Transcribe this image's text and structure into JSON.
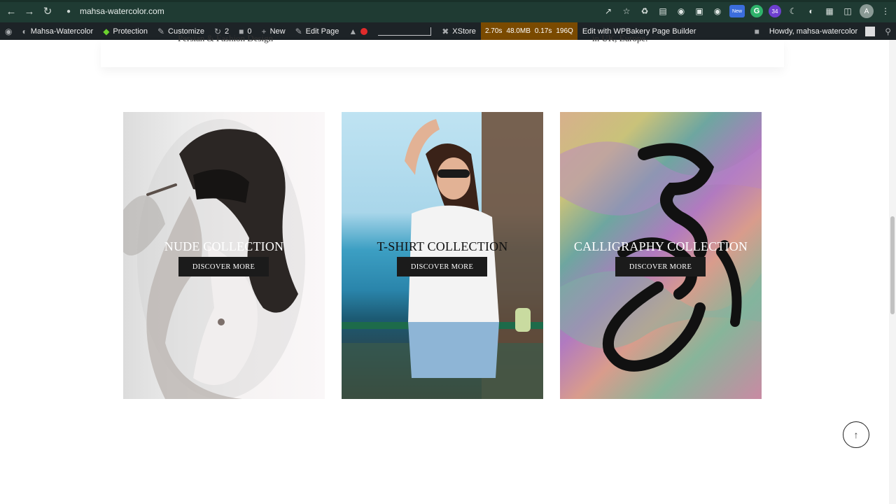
{
  "browser": {
    "url": "mahsa-watercolor.com",
    "ext_new_label": "New",
    "ext_count_label": "34",
    "profile_initial": "A",
    "grammarly_label": "G"
  },
  "admin_bar": {
    "site_name": "Mahsa-Watercolor",
    "protection": "Protection",
    "customize": "Customize",
    "updates_count": "2",
    "comments_count": "0",
    "new": "New",
    "edit_page": "Edit Page",
    "xstore": "XStore",
    "perf": {
      "time": "2.70s",
      "memory": "48.0MB",
      "query_time": "0.17s",
      "queries": "196Q"
    },
    "wpbakery": "Edit with WPBakery Page Builder",
    "howdy": "Howdy, mahsa-watercolor"
  },
  "prev_section": {
    "left_fragment": "Persian & Fashion Design",
    "right_fragment": "in UK, Europe."
  },
  "collections": [
    {
      "title": "NUDE COLLECTION",
      "button": "DISCOVER MORE"
    },
    {
      "title": "T-SHIRT COLLECTION",
      "button": "DISCOVER MORE"
    },
    {
      "title": "CALLIGRAPHY COLLECTION",
      "button": "DISCOVER MORE"
    }
  ],
  "icons": {
    "back": "arrow-left-icon",
    "forward": "arrow-right-icon",
    "reload": "reload-icon",
    "lock": "lock-icon",
    "share": "share-icon",
    "bookmark": "star-icon",
    "extensions": "puzzle-icon",
    "back_to_top": "arrow-up-icon"
  }
}
